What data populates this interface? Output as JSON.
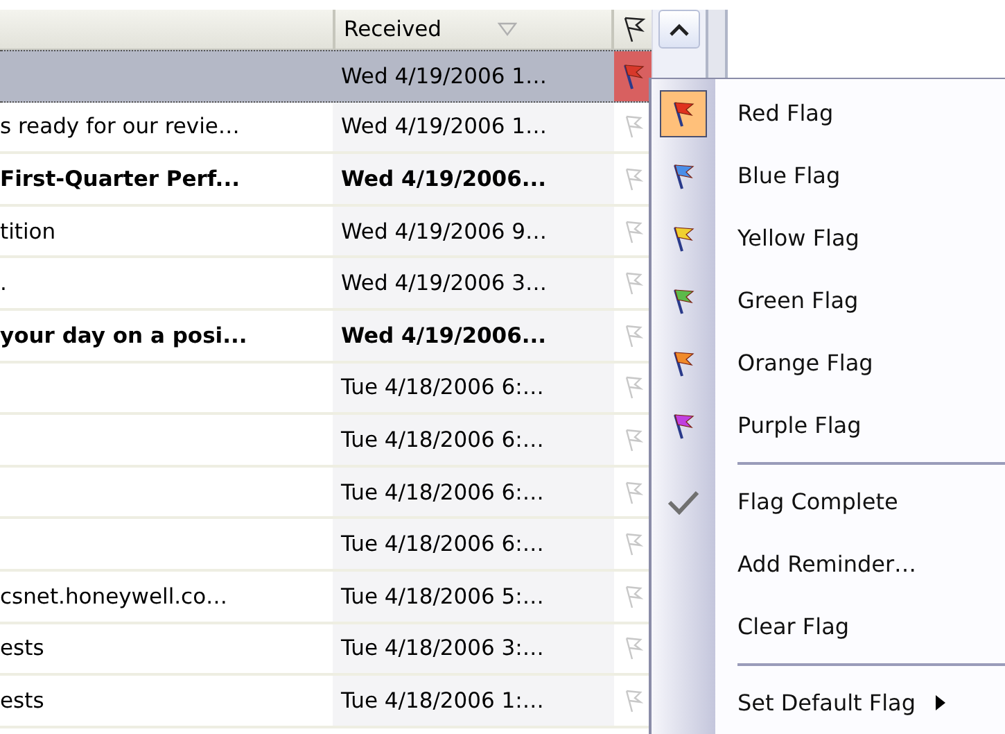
{
  "table": {
    "columns": [
      {
        "label": "Received",
        "sorted": true
      }
    ],
    "rows": [
      {
        "subject": "",
        "received": "Wed 4/19/2006 1…",
        "unread": false,
        "selected": true,
        "flagged": true,
        "color": "#d8382a"
      },
      {
        "subject": "s ready for our revie…",
        "received": "Wed 4/19/2006 1…",
        "unread": false,
        "selected": false,
        "flagged": false
      },
      {
        "subject": "First-Quarter Perf...",
        "received": "Wed 4/19/2006...",
        "unread": true,
        "selected": false,
        "flagged": false
      },
      {
        "subject": "tition",
        "received": "Wed 4/19/2006 9…",
        "unread": false,
        "selected": false,
        "flagged": false
      },
      {
        "subject": ".",
        "received": "Wed 4/19/2006 3…",
        "unread": false,
        "selected": false,
        "flagged": false
      },
      {
        "subject": "your day on a posi...",
        "received": "Wed 4/19/2006...",
        "unread": true,
        "selected": false,
        "flagged": false
      },
      {
        "subject": "",
        "received": "Tue 4/18/2006 6:…",
        "unread": false,
        "selected": false,
        "flagged": false
      },
      {
        "subject": "",
        "received": "Tue 4/18/2006 6:…",
        "unread": false,
        "selected": false,
        "flagged": false
      },
      {
        "subject": "",
        "received": "Tue 4/18/2006 6:…",
        "unread": false,
        "selected": false,
        "flagged": false
      },
      {
        "subject": "",
        "received": "Tue 4/18/2006 6:…",
        "unread": false,
        "selected": false,
        "flagged": false
      },
      {
        "subject": "csnet.honeywell.co…",
        "received": "Tue 4/18/2006 5:…",
        "unread": false,
        "selected": false,
        "flagged": false
      },
      {
        "subject": "ests",
        "received": "Tue 4/18/2006 3:…",
        "unread": false,
        "selected": false,
        "flagged": false
      },
      {
        "subject": "ests",
        "received": "Tue 4/18/2006 1:…",
        "unread": false,
        "selected": false,
        "flagged": false
      }
    ]
  },
  "menu": {
    "items": [
      {
        "kind": "flag",
        "label": "Red Flag",
        "color": "#e0321e",
        "checked": true
      },
      {
        "kind": "flag",
        "label": "Blue Flag",
        "color": "#4a8ee8",
        "checked": false
      },
      {
        "kind": "flag",
        "label": "Yellow Flag",
        "color": "#f0d030",
        "checked": false
      },
      {
        "kind": "flag",
        "label": "Green Flag",
        "color": "#5cba4a",
        "checked": false
      },
      {
        "kind": "flag",
        "label": "Orange Flag",
        "color": "#f08a2a",
        "checked": false
      },
      {
        "kind": "flag",
        "label": "Purple Flag",
        "color": "#c040e0",
        "checked": false
      },
      {
        "kind": "separator"
      },
      {
        "kind": "check",
        "label": "Flag Complete"
      },
      {
        "kind": "plain",
        "label": "Add Reminder…"
      },
      {
        "kind": "plain",
        "label": "Clear Flag"
      },
      {
        "kind": "separator"
      },
      {
        "kind": "submenu",
        "label": "Set Default Flag"
      }
    ]
  }
}
